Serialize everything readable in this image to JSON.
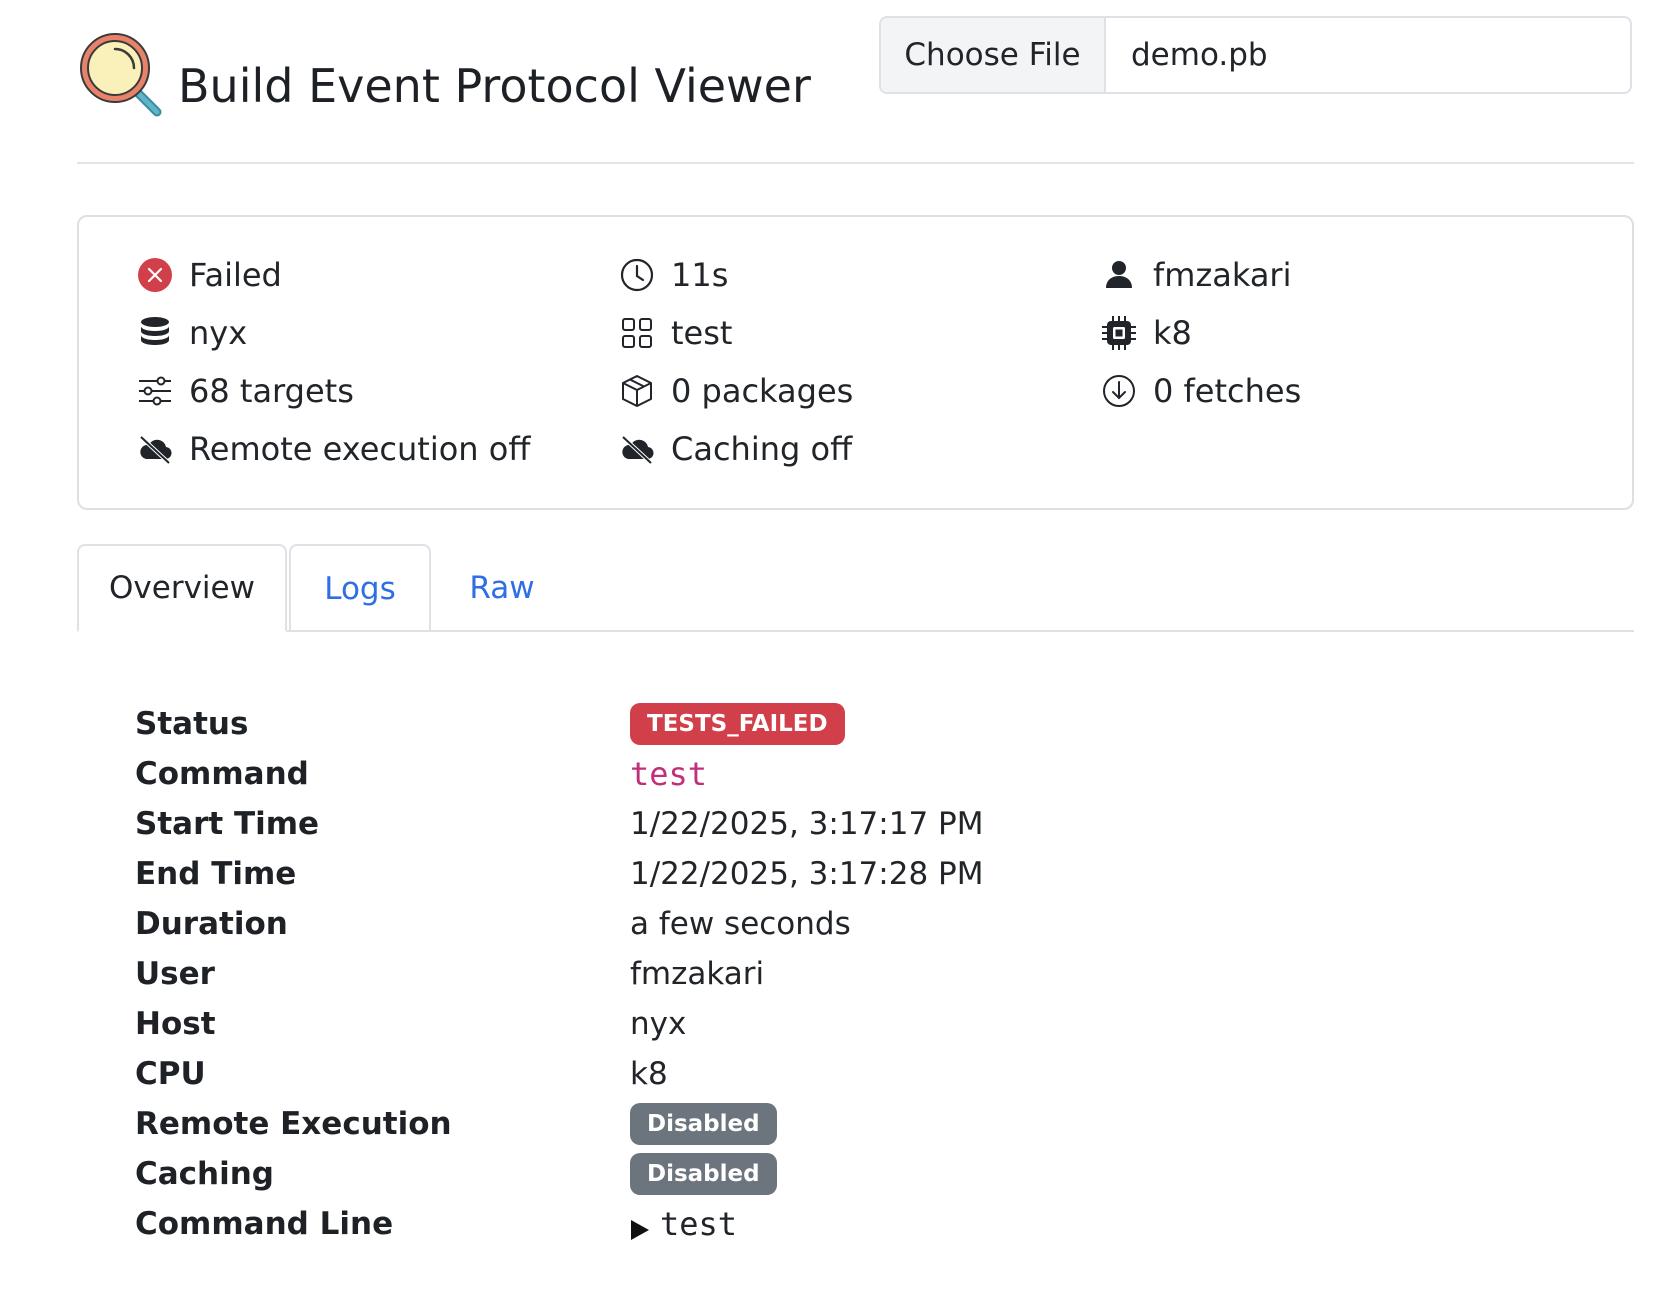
{
  "header": {
    "title": "Build Event Protocol Viewer",
    "file_button_label": "Choose File",
    "file_name": "demo.pb",
    "logo_icon": "magnifier-logo-icon"
  },
  "summary": {
    "status": {
      "label": "Failed",
      "icon": "x-circle-icon",
      "color": "#d1404a"
    },
    "duration": {
      "label": "11s",
      "icon": "clock-icon"
    },
    "user": {
      "label": "fmzakari",
      "icon": "person-icon"
    },
    "host": {
      "label": "nyx",
      "icon": "database-icon"
    },
    "command": {
      "label": "test",
      "icon": "grid-icon"
    },
    "cpu": {
      "label": "k8",
      "icon": "cpu-icon"
    },
    "targets": {
      "label": "68 targets",
      "icon": "sliders-icon"
    },
    "packages": {
      "label": "0 packages",
      "icon": "box-icon"
    },
    "fetches": {
      "label": "0 fetches",
      "icon": "download-circle-icon"
    },
    "remote_execution": {
      "label": "Remote execution off",
      "icon": "cloud-slash-icon"
    },
    "caching": {
      "label": "Caching off",
      "icon": "cloud-slash-icon"
    }
  },
  "tabs": [
    {
      "label": "Overview",
      "active": true
    },
    {
      "label": "Logs",
      "active": false
    },
    {
      "label": "Raw",
      "active": false
    }
  ],
  "details": {
    "status": {
      "label": "Status",
      "value": "TESTS_FAILED"
    },
    "command": {
      "label": "Command",
      "value": "test"
    },
    "start_time": {
      "label": "Start Time",
      "value": "1/22/2025, 3:17:17 PM"
    },
    "end_time": {
      "label": "End Time",
      "value": "1/22/2025, 3:17:28 PM"
    },
    "duration": {
      "label": "Duration",
      "value": "a few seconds"
    },
    "user": {
      "label": "User",
      "value": "fmzakari"
    },
    "host": {
      "label": "Host",
      "value": "nyx"
    },
    "cpu": {
      "label": "CPU",
      "value": "k8"
    },
    "remote_execution": {
      "label": "Remote Execution",
      "value": "Disabled"
    },
    "caching": {
      "label": "Caching",
      "value": "Disabled"
    },
    "command_line": {
      "label": "Command Line",
      "value": "test"
    }
  },
  "colors": {
    "accent_link": "#2f6fe4",
    "danger": "#d1404a",
    "secondary": "#6c757d",
    "code": "#c0307a"
  }
}
